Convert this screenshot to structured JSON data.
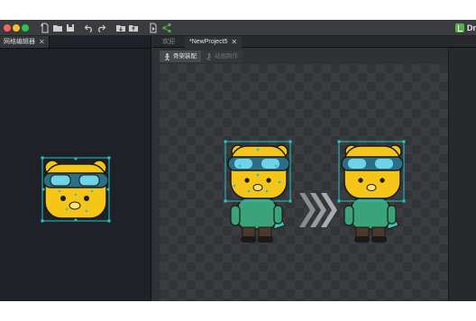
{
  "app": {
    "name": "Dr"
  },
  "toolbar": {
    "icons": [
      "new-file-icon",
      "open-folder-icon",
      "save-icon",
      "undo-icon",
      "redo-icon",
      "import-icon",
      "export-icon",
      "publish-icon",
      "share-icon"
    ]
  },
  "left_panel": {
    "tab_label": "网格编辑器",
    "close": "✕"
  },
  "editor": {
    "tabs": [
      {
        "label": "欢迎"
      },
      {
        "label": "*NewProject5",
        "close": "✕"
      }
    ],
    "modes": [
      {
        "label": "骨架装配",
        "icon": "armature-icon"
      },
      {
        "label": "动画制作",
        "icon": "animation-icon"
      }
    ]
  },
  "colors": {
    "accent": "#58b04a",
    "bbox": "#22c6c6",
    "bear": "#f5c518",
    "hoodie": "#3aa37a"
  }
}
